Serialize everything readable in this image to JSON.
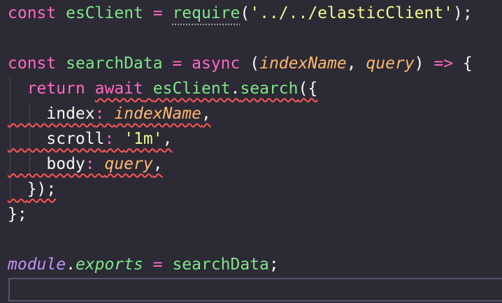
{
  "editor": {
    "line1": {
      "kw": "const",
      "name": "esClient",
      "eq": " = ",
      "fn": "require",
      "open": "(",
      "str": "'../../elasticClient'",
      "close": ");"
    },
    "line3": {
      "kw": "const",
      "name": "searchData",
      "eq": " = ",
      "async": "async",
      "open": " (",
      "p1": "indexName",
      "comma": ", ",
      "p2": "query",
      "close": ") ",
      "arrow": "=>",
      "brace": " {"
    },
    "line4": {
      "ret": "return",
      "await": "await",
      "client": "esClient",
      "dot": ".",
      "method": "search",
      "open": "({"
    },
    "line5": {
      "key": "index",
      "colon": ": ",
      "val": "indexName",
      "comma": ","
    },
    "line6": {
      "key": "scroll",
      "colon": ": ",
      "val": "'1m'",
      "comma": ","
    },
    "line7": {
      "key": "body",
      "colon": ": ",
      "val": "query",
      "comma": ","
    },
    "line8": {
      "text": "});"
    },
    "line9": {
      "text": "};"
    },
    "line11": {
      "mod": "module",
      "dot": ".",
      "exp": "exports",
      "eq": " = ",
      "val": "searchData",
      "semi": ";"
    }
  },
  "colors": {
    "background": "#2c2a35",
    "keyword": "#ff6ac1",
    "function": "#7ee787",
    "string": "#f1fa8c",
    "parameter": "#ffb86c",
    "module": "#bd93f9",
    "error_squiggle": "#ff5555"
  }
}
